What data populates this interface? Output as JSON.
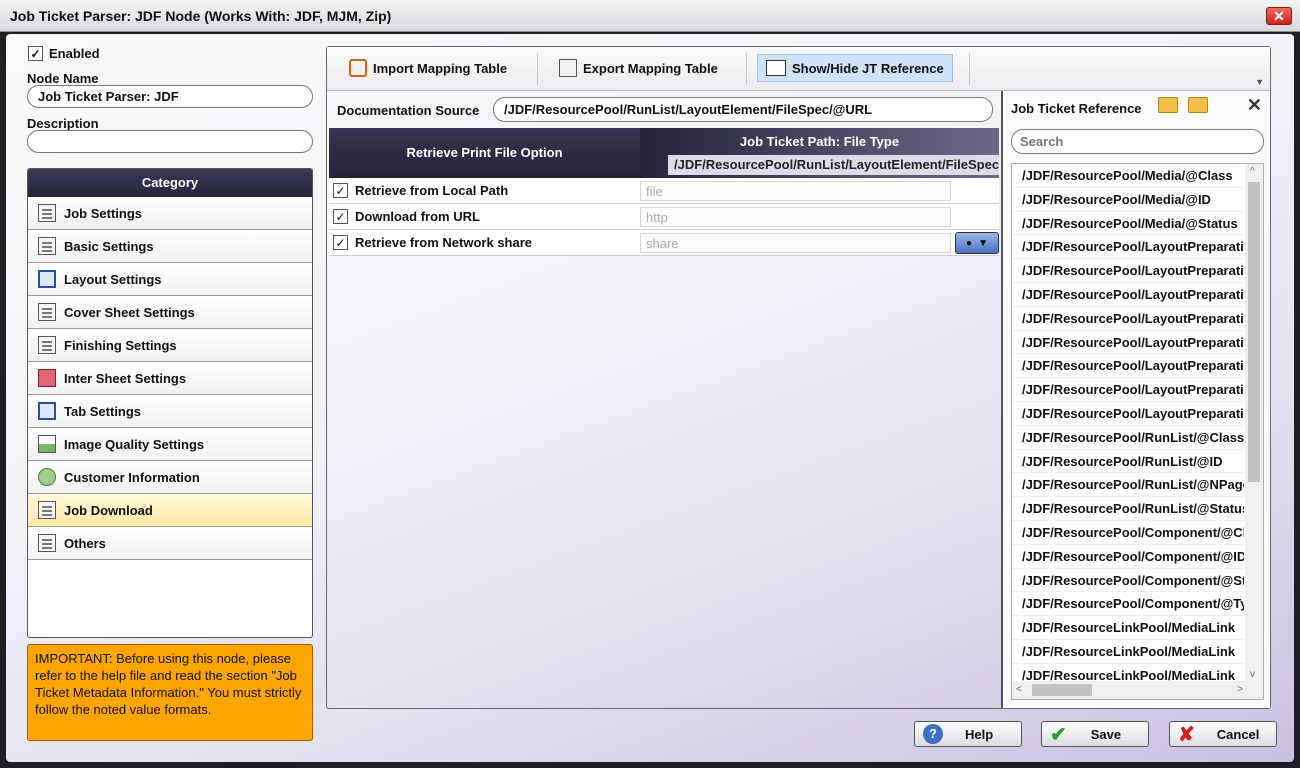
{
  "window": {
    "title": "Job Ticket Parser: JDF Node (Works With: JDF, MJM, Zip)",
    "close": "✕"
  },
  "left": {
    "enabled_label": "Enabled",
    "node_name_label": "Node Name",
    "node_name_value": "Job Ticket Parser: JDF",
    "description_label": "Description",
    "description_value": "",
    "category_header": "Category",
    "categories": [
      {
        "label": "Job Settings",
        "icon": "document-icon"
      },
      {
        "label": "Basic Settings",
        "icon": "list-icon"
      },
      {
        "label": "Layout Settings",
        "icon": "layout-icon"
      },
      {
        "label": "Cover Sheet Settings",
        "icon": "cover-sheet-icon"
      },
      {
        "label": "Finishing Settings",
        "icon": "finishing-icon"
      },
      {
        "label": "Inter Sheet Settings",
        "icon": "inter-sheet-icon"
      },
      {
        "label": "Tab Settings",
        "icon": "tab-icon"
      },
      {
        "label": "Image Quality Settings",
        "icon": "image-icon"
      },
      {
        "label": "Customer Information",
        "icon": "customer-icon"
      },
      {
        "label": "Job Download",
        "icon": "download-icon",
        "active": true
      },
      {
        "label": "Others",
        "icon": "others-icon"
      }
    ],
    "important_text": "IMPORTANT: Before using this node, please refer to the help file and read the section \"Job Ticket Metadata Information.\" You must strictly follow the noted value formats."
  },
  "toolbar": {
    "import_label": "Import Mapping Table",
    "export_label": "Export Mapping Table",
    "showhide_label": "Show/Hide JT Reference"
  },
  "doc_source": {
    "label": "Documentation Source",
    "value": "/JDF/ResourcePool/RunList/LayoutElement/FileSpec/@URL"
  },
  "mapping": {
    "col_option": "Retrieve Print File Option",
    "col_path": "Job Ticket Path: File Type",
    "path_value": "/JDF/ResourcePool/RunList/LayoutElement/FileSpec/@URL",
    "rows": [
      {
        "name": "Retrieve from Local Path",
        "value": "file",
        "checked": true
      },
      {
        "name": "Download from URL",
        "value": "http",
        "checked": true
      },
      {
        "name": "Retrieve from Network share",
        "value": "share",
        "checked": true
      }
    ]
  },
  "jt_reference": {
    "title": "Job Ticket Reference",
    "search_placeholder": "Search",
    "items": [
      "/JDF/ResourcePool/Media/@Class",
      "/JDF/ResourcePool/Media/@ID",
      "/JDF/ResourcePool/Media/@Status",
      "/JDF/ResourcePool/LayoutPreparationParams",
      "/JDF/ResourcePool/LayoutPreparationParams",
      "/JDF/ResourcePool/LayoutPreparationParams",
      "/JDF/ResourcePool/LayoutPreparationParams",
      "/JDF/ResourcePool/LayoutPreparationParams",
      "/JDF/ResourcePool/LayoutPreparationParams",
      "/JDF/ResourcePool/LayoutPreparationParams",
      "/JDF/ResourcePool/LayoutPreparationParams",
      "/JDF/ResourcePool/RunList/@Class",
      "/JDF/ResourcePool/RunList/@ID",
      "/JDF/ResourcePool/RunList/@NPage",
      "/JDF/ResourcePool/RunList/@Status",
      "/JDF/ResourcePool/Component/@Class",
      "/JDF/ResourcePool/Component/@ID",
      "/JDF/ResourcePool/Component/@Status",
      "/JDF/ResourcePool/Component/@Type",
      "/JDF/ResourceLinkPool/MediaLink",
      "/JDF/ResourceLinkPool/MediaLink",
      "/JDF/ResourceLinkPool/MediaLink"
    ]
  },
  "footer": {
    "help_label": "Help",
    "save_label": "Save",
    "cancel_label": "Cancel"
  }
}
